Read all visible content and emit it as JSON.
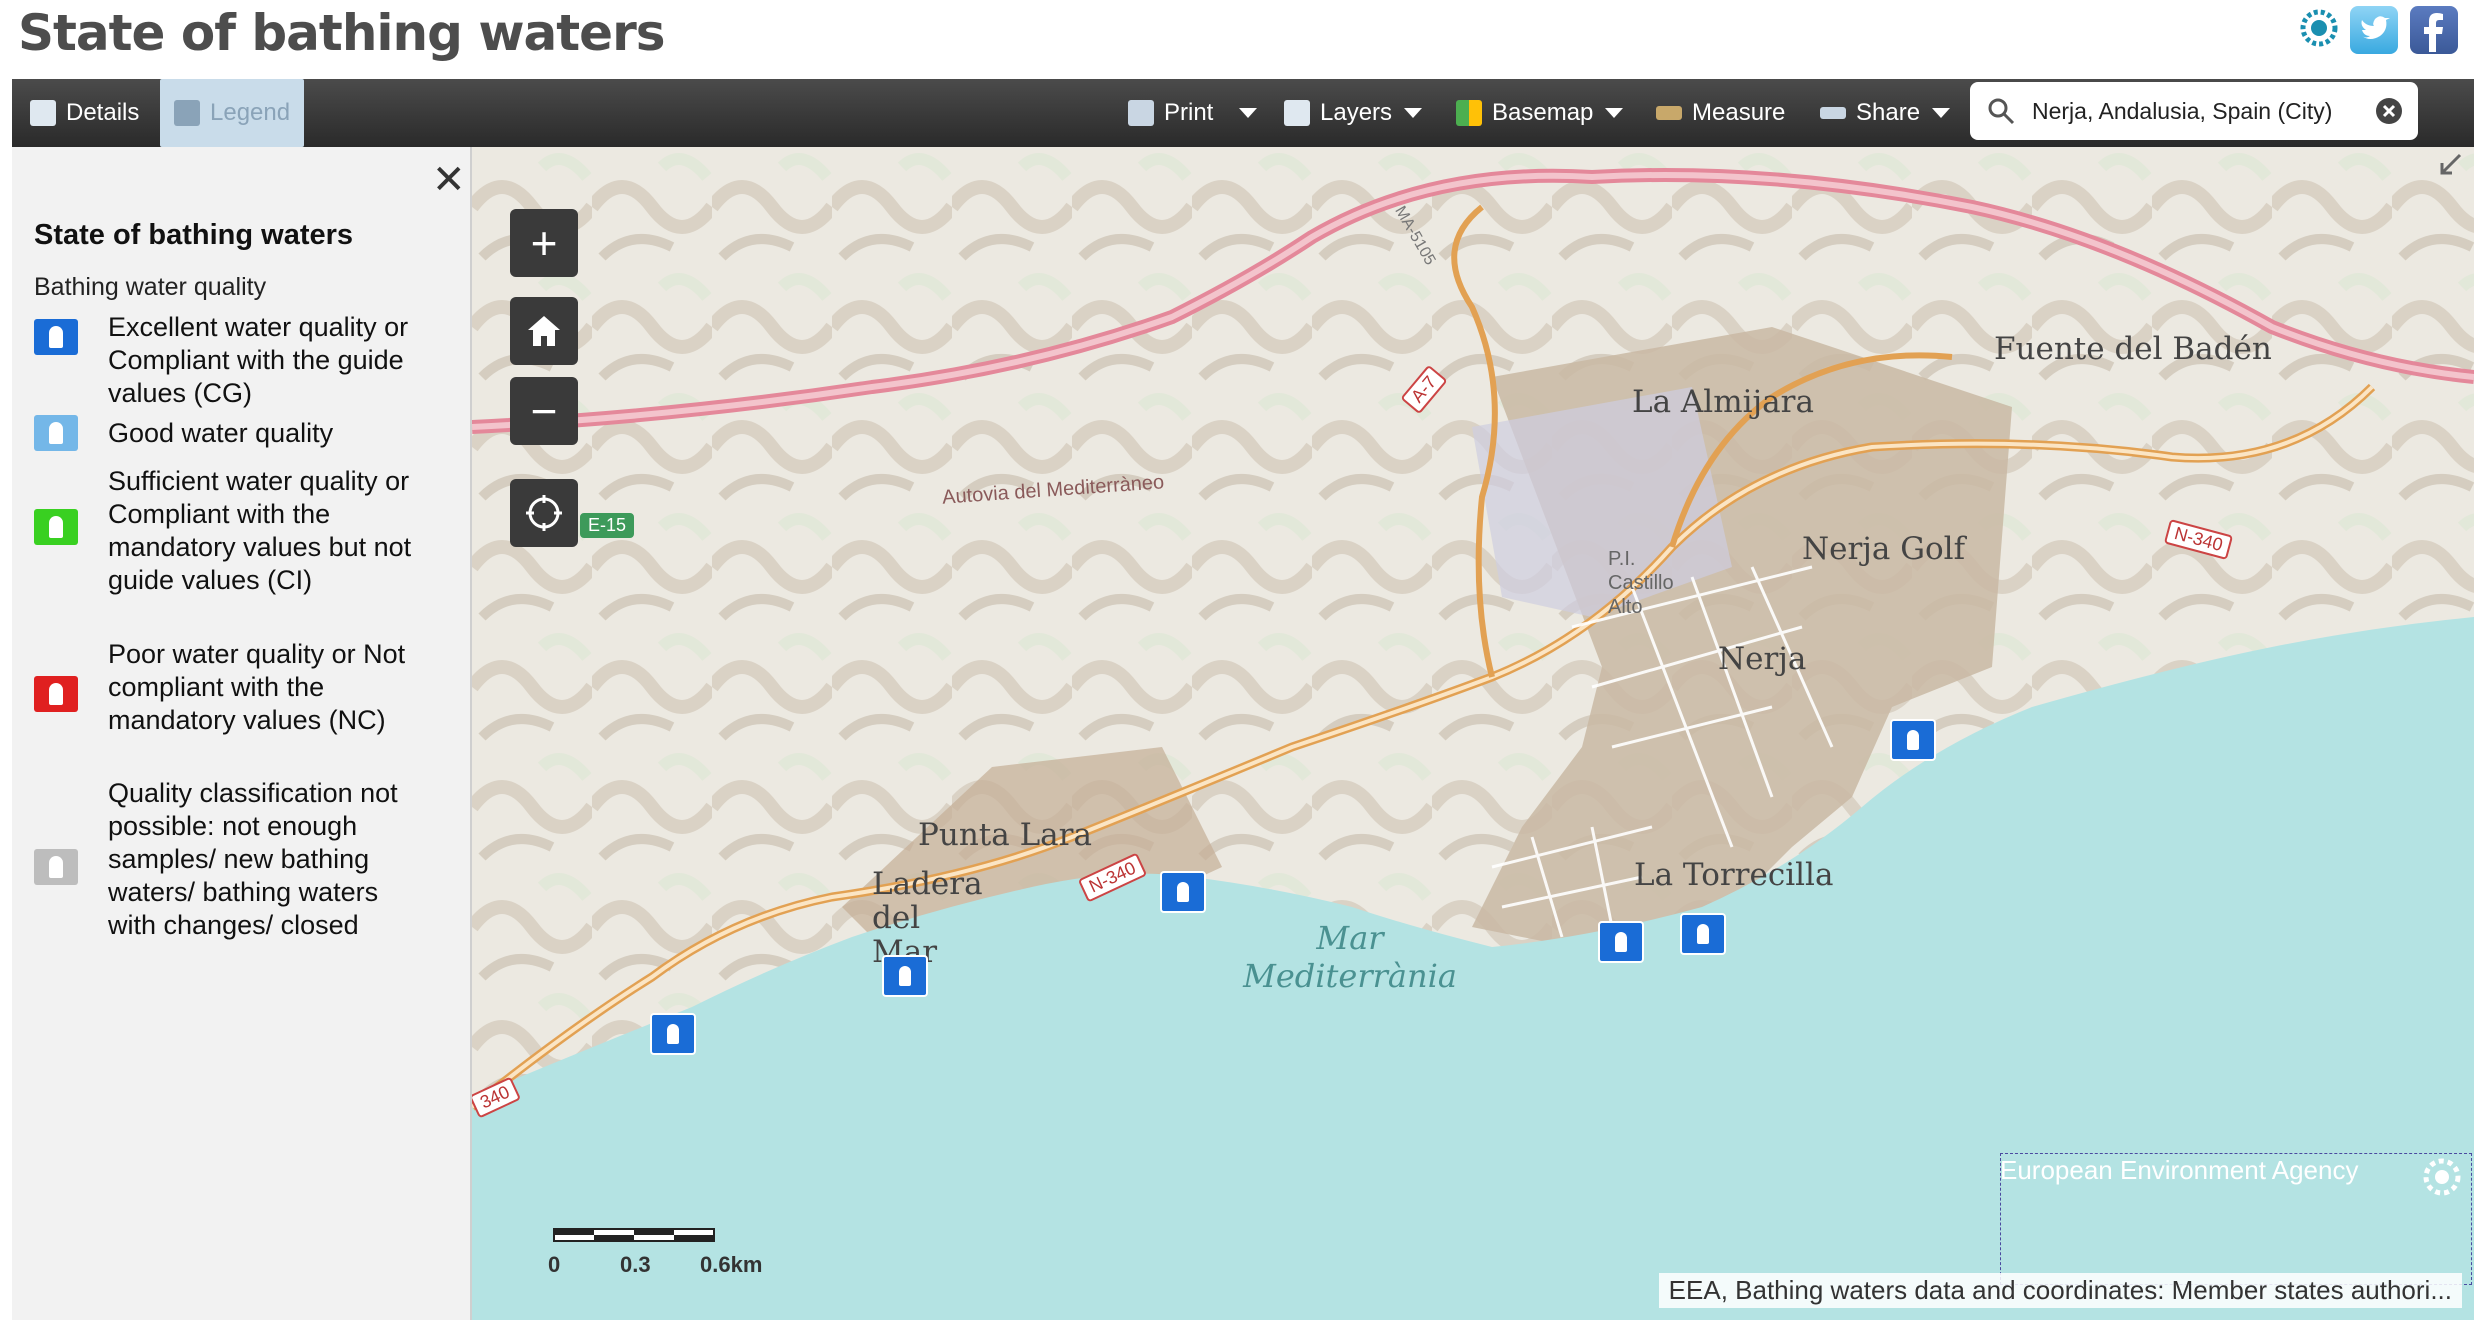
{
  "header": {
    "title": "State of bathing waters"
  },
  "social": {
    "eea": "eea-logo",
    "twitter": "twitter-icon",
    "facebook": "facebook-icon"
  },
  "toolbar": {
    "details": "Details",
    "legend": "Legend",
    "print": "Print",
    "layers": "Layers",
    "basemap": "Basemap",
    "measure": "Measure",
    "share": "Share"
  },
  "search": {
    "value": "Nerja, Andalusia, Spain (City)"
  },
  "legend": {
    "title": "State of bathing waters",
    "subtitle": "Bathing water quality",
    "items": [
      {
        "label": "Excellent water quality or Compliant with the guide values (CG)",
        "color": "#1a6cd6"
      },
      {
        "label": "Good water quality",
        "color": "#74b7e8"
      },
      {
        "label": "Sufficient water quality or Compliant with the mandatory values but not guide values (CI)",
        "color": "#39d021"
      },
      {
        "label": "Poor water quality or Not compliant with the mandatory values (NC)",
        "color": "#e02020"
      },
      {
        "label": "Quality classification not possible: not enough samples/ new bathing waters/ bathing waters with changes/ closed",
        "color": "#bdbdbd"
      }
    ]
  },
  "map": {
    "places": {
      "fuente": "Fuente del Badén",
      "almijara": "La Almijara",
      "castillo": "P.I. Castillo Alto",
      "nerja_golf": "Nerja Golf",
      "nerja": "Nerja",
      "punta_lara": "Punta Lara",
      "ladera": "Ladera del Mar",
      "torrecilla": "La Torrecilla",
      "sea": "Mar Mediterrània",
      "autovia": "Autovia del Mediterràneo",
      "ma5105": "MA-5105"
    },
    "roads": {
      "a7": "A-7",
      "e15": "E-15",
      "n340": "N-340",
      "n340_edge": "340"
    },
    "scale": {
      "t0": "0",
      "t1": "0.3",
      "t2": "0.6km"
    },
    "attribution": "EEA, Bathing waters data and coordinates: Member states authori...",
    "agency": "European Environment Agency"
  }
}
